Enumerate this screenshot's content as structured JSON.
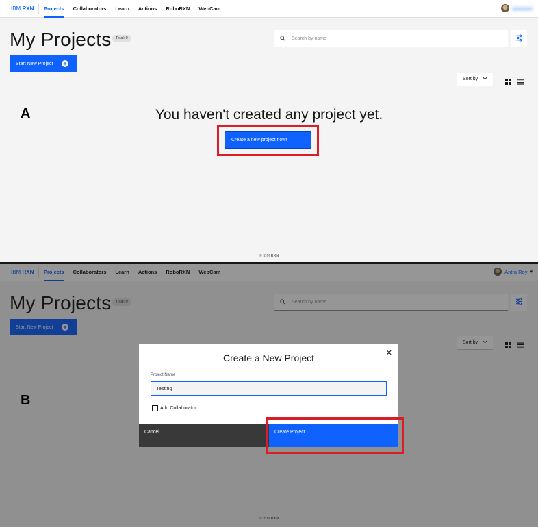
{
  "nav": {
    "brand_prefix": "IBM",
    "brand_name": "RXN",
    "items": [
      {
        "label": "Projects",
        "active": true
      },
      {
        "label": "Collaborators"
      },
      {
        "label": "Learn"
      },
      {
        "label": "Actions"
      },
      {
        "label": "RoboRXN"
      },
      {
        "label": "WebCam"
      }
    ],
    "user_name_b": "Antra Roy"
  },
  "header": {
    "title": "My Projects",
    "total_badge": "Total: 0",
    "search_placeholder": "Search by name",
    "start_button": "Start New Project",
    "sort_label": "Sort by"
  },
  "panel_a": {
    "letter": "A",
    "empty_message": "You haven't created any project yet.",
    "create_now_button": "Create a new project now!"
  },
  "panel_b": {
    "letter": "B",
    "modal": {
      "title": "Create a New Project",
      "field_label": "Project Name",
      "field_value": "Testing",
      "checkbox_label": "Add Collaborator",
      "cancel_label": "Cancel",
      "create_label": "Create Project"
    }
  },
  "footer": {
    "prefix": "© IBM",
    "name": "RXN"
  },
  "colors": {
    "accent": "#0f62fe",
    "highlight": "#da1e28",
    "background": "#f4f4f4"
  },
  "icons": [
    "search-icon",
    "filter-icon",
    "add-icon",
    "chevron-down-icon",
    "grid-view-icon",
    "list-view-icon",
    "close-icon"
  ]
}
